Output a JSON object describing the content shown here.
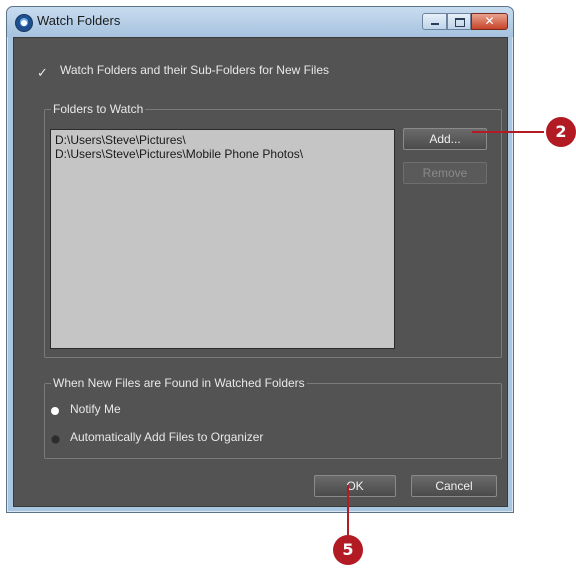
{
  "window": {
    "title": "Watch Folders",
    "close_glyph": "✕"
  },
  "options": {
    "watch_subfolders_label": "Watch Folders and their Sub-Folders for New Files",
    "watch_subfolders_checked": true,
    "check_glyph": "✓"
  },
  "folders_group": {
    "legend": "Folders to Watch",
    "items": [
      "D:\\Users\\Steve\\Pictures\\",
      "D:\\Users\\Steve\\Pictures\\Mobile Phone Photos\\"
    ],
    "add_label": "Add...",
    "remove_label": "Remove"
  },
  "found_group": {
    "legend": "When New Files are Found in Watched Folders",
    "options": [
      {
        "label": "Notify Me",
        "selected": true
      },
      {
        "label": "Automatically Add Files to Organizer",
        "selected": false
      }
    ]
  },
  "footer": {
    "ok_label": "OK",
    "cancel_label": "Cancel"
  },
  "callouts": {
    "add_step": "2",
    "ok_step": "5",
    "color": "#b21a24"
  },
  "icons": [
    "app-icon",
    "minimize-icon",
    "maximize-icon",
    "close-icon",
    "checkbox-icon",
    "radio-selected-icon",
    "radio-unselected-icon"
  ]
}
